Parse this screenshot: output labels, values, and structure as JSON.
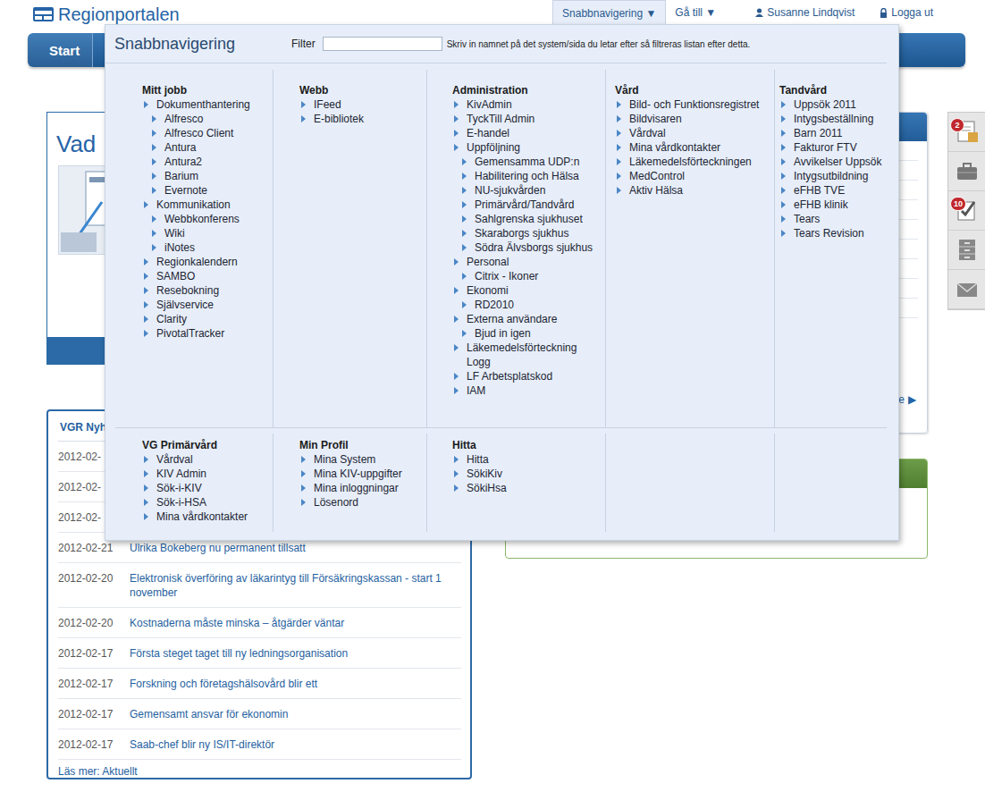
{
  "header": {
    "logo": "Regionportalen",
    "nav": [
      {
        "label": "Snabbnavigering ▼",
        "selected": true
      },
      {
        "label": "Gå till ▼",
        "selected": false
      }
    ],
    "user": "Susanne Lindqvist",
    "logout": "Logga ut"
  },
  "navbar": {
    "tabs": [
      {
        "label": "Start",
        "selected": true
      }
    ]
  },
  "intro": {
    "title": "Vad"
  },
  "news": {
    "title": "VGR Nyhe",
    "items": [
      {
        "date": "2012-02-",
        "title": ""
      },
      {
        "date": "2012-02-",
        "title": ""
      },
      {
        "date": "2012-02-",
        "title": ""
      },
      {
        "date": "2012-02-21",
        "title": "Ulrika Bokeberg nu permanent tillsatt"
      },
      {
        "date": "2012-02-20",
        "title": "Elektronisk överföring av läkarintyg till Försäkringskassan - start 1 november"
      },
      {
        "date": "2012-02-20",
        "title": "Kostnaderna måste minska – åtgärder väntar"
      },
      {
        "date": "2012-02-17",
        "title": "Första steget taget till ny ledningsorganisation"
      },
      {
        "date": "2012-02-17",
        "title": "Forskning och företagshälsovård blir ett"
      },
      {
        "date": "2012-02-17",
        "title": "Gemensamt ansvar för ekonomin"
      },
      {
        "date": "2012-02-17",
        "title": "Saab-chef blir ny IS/IT-direktör"
      }
    ],
    "more": "Läs mer: Aktuellt"
  },
  "right_box": {
    "link_fragment": "e",
    "arrow": "▶"
  },
  "toolbar": [
    {
      "badge": "2"
    },
    {
      "badge": ""
    },
    {
      "badge": "10"
    },
    {
      "badge": ""
    },
    {
      "badge": ""
    }
  ],
  "quicknav": {
    "title": "Snabbnavigering",
    "filter_label": "Filter",
    "filter_value": "",
    "hint": "Skriv in namnet på det system/sida du letar efter så filtreras listan efter detta.",
    "sections": [
      {
        "columns": [
          {
            "title": "Mitt jobb",
            "items": [
              {
                "label": "Dokumenthantering",
                "kind": "item"
              },
              {
                "label": "Alfresco",
                "kind": "sub"
              },
              {
                "label": "Alfresco Client",
                "kind": "sub"
              },
              {
                "label": "Antura",
                "kind": "sub"
              },
              {
                "label": "Antura2",
                "kind": "sub"
              },
              {
                "label": "Barium",
                "kind": "sub"
              },
              {
                "label": "Evernote",
                "kind": "sub"
              },
              {
                "label": "Kommunikation",
                "kind": "item"
              },
              {
                "label": "Webbkonferens",
                "kind": "sub"
              },
              {
                "label": "Wiki",
                "kind": "sub"
              },
              {
                "label": "iNotes",
                "kind": "sub"
              },
              {
                "label": "Regionkalendern",
                "kind": "item"
              },
              {
                "label": "SAMBO",
                "kind": "item"
              },
              {
                "label": "Resebokning",
                "kind": "item"
              },
              {
                "label": "Självservice",
                "kind": "item"
              },
              {
                "label": "Clarity",
                "kind": "item"
              },
              {
                "label": "PivotalTracker",
                "kind": "item"
              }
            ]
          },
          {
            "title": "Webb",
            "items": [
              {
                "label": "IFeed",
                "kind": "item"
              },
              {
                "label": "E-bibliotek",
                "kind": "item"
              }
            ]
          },
          {
            "title": "Administration",
            "items": [
              {
                "label": "KivAdmin",
                "kind": "item"
              },
              {
                "label": "TyckTill Admin",
                "kind": "item"
              },
              {
                "label": "E-handel",
                "kind": "item"
              },
              {
                "label": "Uppföljning",
                "kind": "item"
              },
              {
                "label": "Gemensamma UDP:n",
                "kind": "sub"
              },
              {
                "label": "Habilitering och Hälsa",
                "kind": "sub"
              },
              {
                "label": "NU-sjukvården",
                "kind": "sub"
              },
              {
                "label": "Primärvård/Tandvård",
                "kind": "sub"
              },
              {
                "label": "Sahlgrenska sjukhuset",
                "kind": "sub"
              },
              {
                "label": "Skaraborgs sjukhus",
                "kind": "sub"
              },
              {
                "label": "Södra Älvsborgs sjukhus",
                "kind": "sub"
              },
              {
                "label": "Personal",
                "kind": "item"
              },
              {
                "label": "Citrix - Ikoner",
                "kind": "sub"
              },
              {
                "label": "Ekonomi",
                "kind": "item"
              },
              {
                "label": "RD2010",
                "kind": "sub"
              },
              {
                "label": "Externa användare",
                "kind": "item"
              },
              {
                "label": "Bjud in igen",
                "kind": "sub"
              },
              {
                "label": "Läkemedelsförteckning Logg",
                "kind": "item"
              },
              {
                "label": "LF Arbetsplatskod",
                "kind": "item"
              },
              {
                "label": "IAM",
                "kind": "item"
              }
            ]
          },
          {
            "title": "Vård",
            "items": [
              {
                "label": "Bild- och Funktionsregistret",
                "kind": "item"
              },
              {
                "label": "Bildvisaren",
                "kind": "item"
              },
              {
                "label": "Vårdval",
                "kind": "item"
              },
              {
                "label": "Mina vårdkontakter",
                "kind": "item"
              },
              {
                "label": "Läkemedelsförteckningen",
                "kind": "item"
              },
              {
                "label": "MedControl",
                "kind": "item"
              },
              {
                "label": "Aktiv Hälsa",
                "kind": "item"
              }
            ]
          },
          {
            "title": "Tandvård",
            "items": [
              {
                "label": "Uppsök 2011",
                "kind": "item"
              },
              {
                "label": "Intygsbeställning",
                "kind": "item"
              },
              {
                "label": "Barn 2011",
                "kind": "item"
              },
              {
                "label": "Fakturor FTV",
                "kind": "item"
              },
              {
                "label": "Avvikelser Uppsök",
                "kind": "item"
              },
              {
                "label": "Intygsutbildning",
                "kind": "item"
              },
              {
                "label": "eFHB TVE",
                "kind": "item"
              },
              {
                "label": "eFHB klinik",
                "kind": "item"
              },
              {
                "label": "Tears",
                "kind": "item"
              },
              {
                "label": "Tears Revision",
                "kind": "item"
              }
            ]
          }
        ]
      },
      {
        "columns": [
          {
            "title": "VG Primärvård",
            "items": [
              {
                "label": "Vårdval",
                "kind": "item"
              },
              {
                "label": "KIV Admin",
                "kind": "item"
              },
              {
                "label": "Sök-i-KIV",
                "kind": "item"
              },
              {
                "label": "Sök-i-HSA",
                "kind": "item"
              },
              {
                "label": "Mina vårdkontakter",
                "kind": "item"
              }
            ]
          },
          {
            "title": "Min Profil",
            "items": [
              {
                "label": "Mina System",
                "kind": "item"
              },
              {
                "label": "Mina KIV-uppgifter",
                "kind": "item"
              },
              {
                "label": "Mina inloggningar",
                "kind": "item"
              },
              {
                "label": "Lösenord",
                "kind": "item"
              }
            ]
          },
          {
            "title": "Hitta",
            "items": [
              {
                "label": "Hitta",
                "kind": "item"
              },
              {
                "label": "SökiKiv",
                "kind": "item"
              },
              {
                "label": "SökiHsa",
                "kind": "item"
              }
            ]
          }
        ]
      }
    ]
  }
}
